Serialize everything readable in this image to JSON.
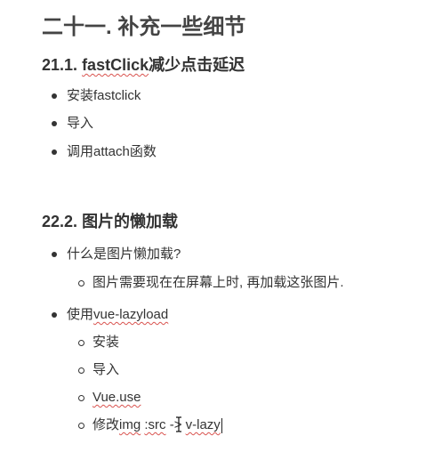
{
  "heading": "二十一. 补充一些细节",
  "section1": {
    "number": "21.1.",
    "title_bold": "fastClick",
    "title_rest": "减少点击延迟",
    "items": [
      "安装fastclick",
      "导入",
      "调用attach函数"
    ]
  },
  "section2": {
    "number": "22.2.",
    "title": "图片的懒加载",
    "q_label": "什么是图片懒加载?",
    "q_answer": "图片需要现在在屏幕上时, 再加载这张图片.",
    "use_prefix": "使用",
    "use_pkg": "vue-lazyload",
    "sub_install": "安装",
    "sub_import": "导入",
    "sub_vueuse": "Vue.use",
    "sub_modify_prefix": "修改",
    "sub_modify_img": "img",
    "sub_modify_src": ":src",
    "sub_modify_arrow": "->",
    "sub_modify_target": "v-lazy"
  }
}
